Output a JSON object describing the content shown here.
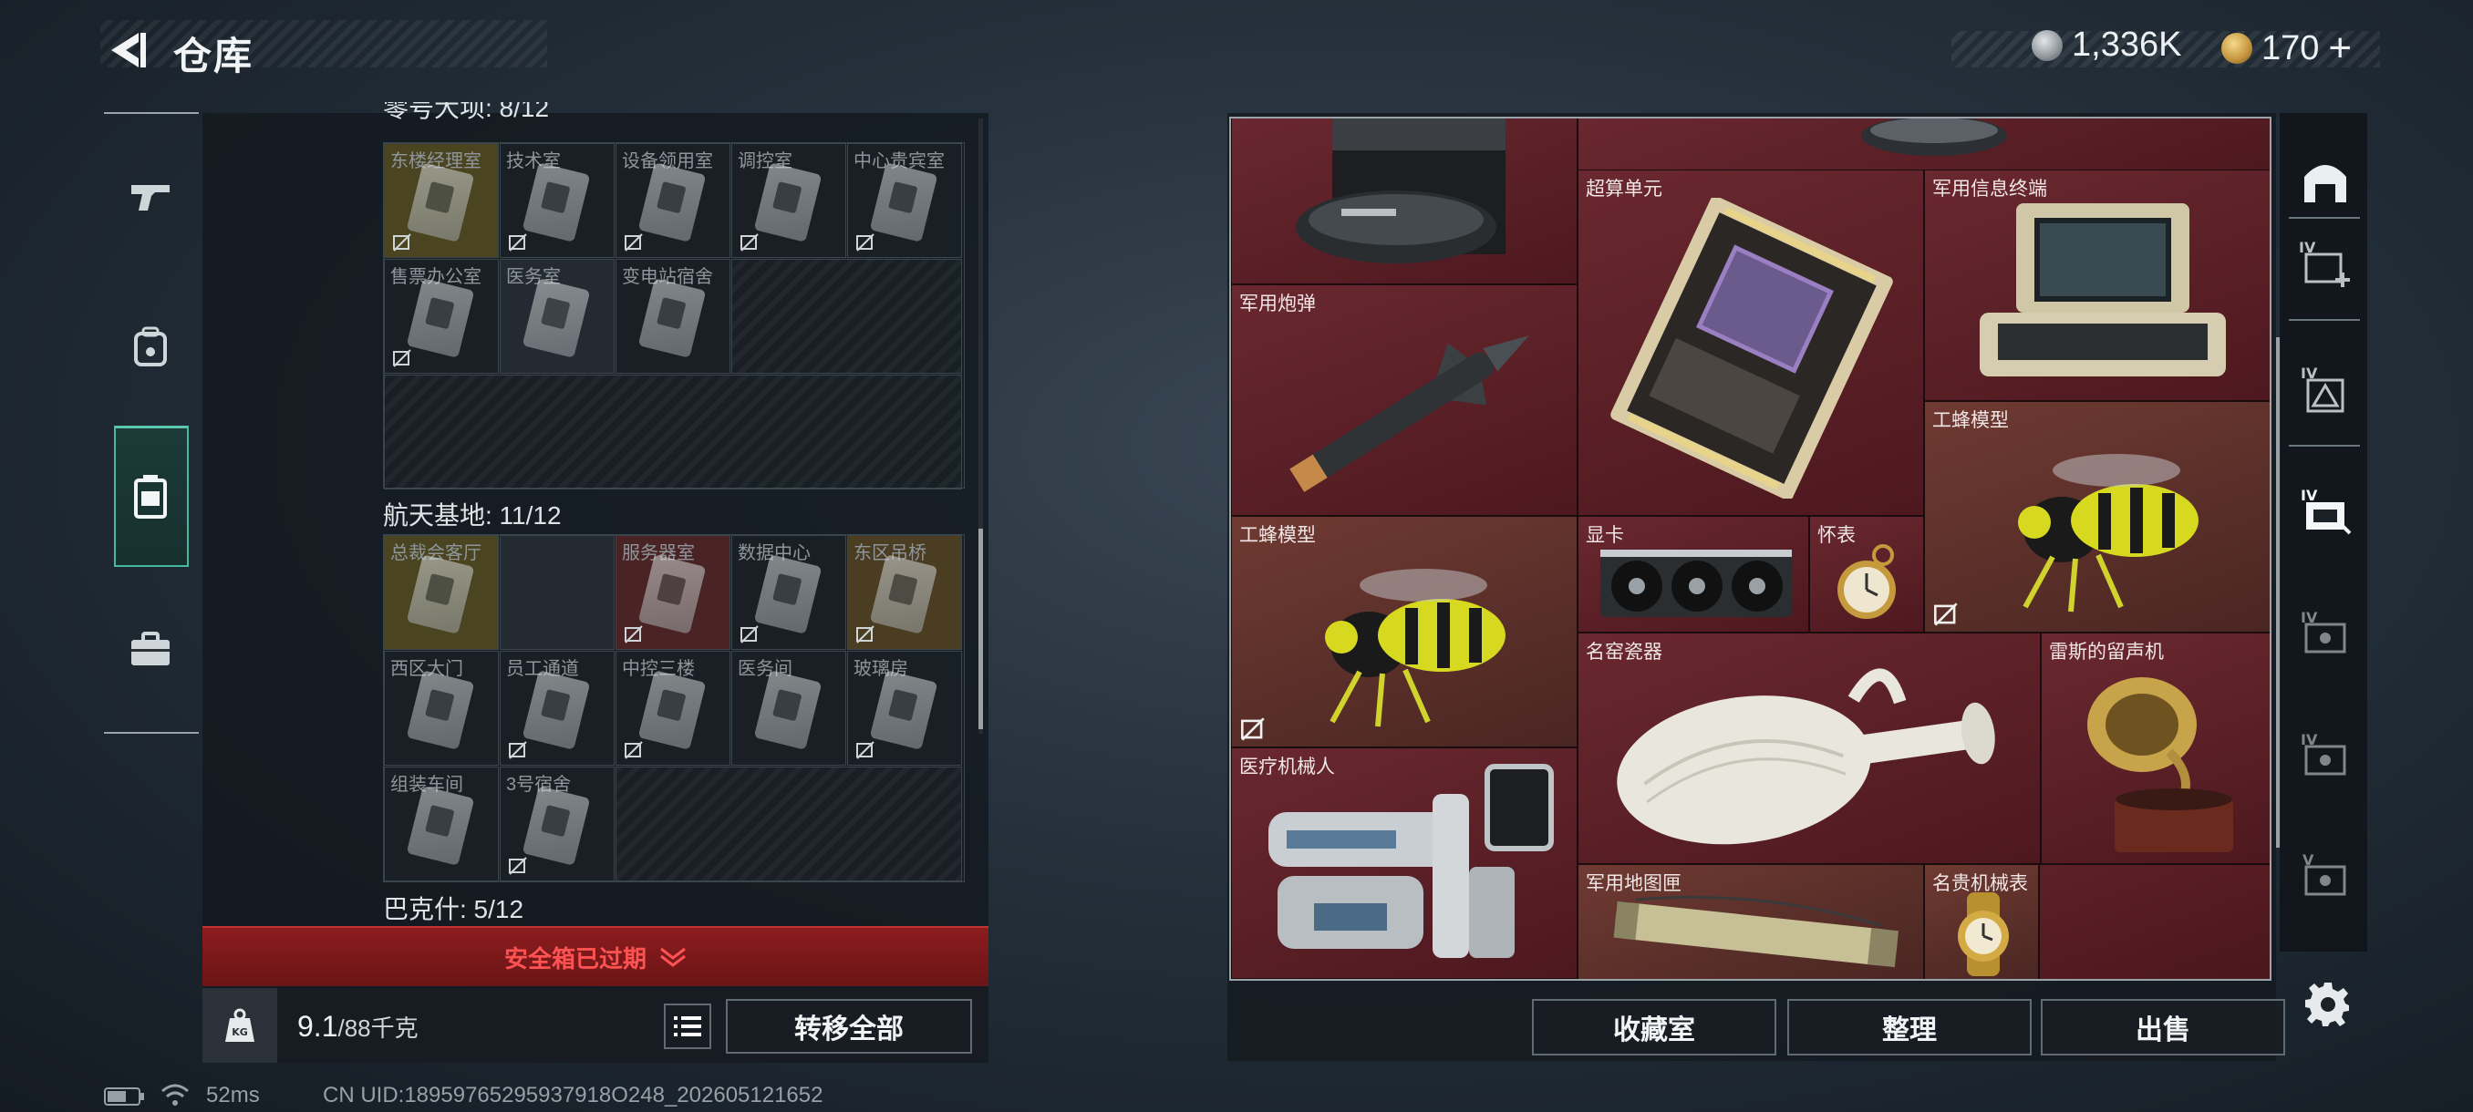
{
  "header": {
    "title": "仓库",
    "currency_1": "1,336K",
    "currency_2": "170",
    "plus": "+"
  },
  "left_rail": {
    "icons": [
      "pistol-icon",
      "backpack-icon",
      "locker-icon",
      "briefcase-icon"
    ],
    "selected": 2
  },
  "sections": [
    {
      "heading_partial": "零号大坝: 8/12",
      "cells": [
        {
          "name": "东楼经理室",
          "locked": true,
          "color": "#6b6322"
        },
        {
          "name": "技术室",
          "locked": true
        },
        {
          "name": "设备领用室",
          "locked": true
        },
        {
          "name": "调控室",
          "locked": true
        },
        {
          "name": "中心贵宾室",
          "locked": true
        },
        {
          "name": "售票办公室",
          "locked": true
        },
        {
          "name": "医务室",
          "locked": false
        },
        {
          "name": "变电站宿舍",
          "locked": false
        }
      ]
    },
    {
      "heading": "航天基地: 11/12",
      "cells": [
        {
          "name": "总裁会客厅",
          "locked": false,
          "color": "#6b6322"
        },
        {
          "name": "",
          "locked": false,
          "empty": true
        },
        {
          "name": "服务器室",
          "locked": true,
          "color": "#5a2a2a"
        },
        {
          "name": "数据中心",
          "locked": true
        },
        {
          "name": "东区吊桥",
          "locked": true,
          "color": "#5b4a28"
        },
        {
          "name": "西区大门",
          "locked": false
        },
        {
          "name": "员工通道",
          "locked": true
        },
        {
          "name": "中控三楼",
          "locked": true
        },
        {
          "name": "医务间",
          "locked": false
        },
        {
          "name": "玻璃房",
          "locked": true
        },
        {
          "name": "组装车间",
          "locked": false
        },
        {
          "name": "3号宿舍",
          "locked": true
        }
      ]
    },
    {
      "heading": "巴克什: 5/12"
    }
  ],
  "warning": "安全箱已过期",
  "footer": {
    "weight": "9.1",
    "capacity": "/88千克",
    "kg_label": "KG",
    "transfer_all": "转移全部"
  },
  "status": {
    "ping": "52ms",
    "uid": "CN UID:18959765295937918O248_202605121652"
  },
  "stash": {
    "items": [
      {
        "name": "超算单元"
      },
      {
        "name": "军用信息终端"
      },
      {
        "name": "军用炮弹"
      },
      {
        "name": "工蜂模型",
        "key": "bee1"
      },
      {
        "name": "工蜂模型",
        "key": "bee2"
      },
      {
        "name": "显卡"
      },
      {
        "name": "怀表"
      },
      {
        "name": "名窑瓷器"
      },
      {
        "name": "雷斯的留声机"
      },
      {
        "name": "医疗机械人"
      },
      {
        "name": "军用地图匣"
      },
      {
        "name": "名贵机械表"
      }
    ]
  },
  "buttons": {
    "collection": "收藏室",
    "organize": "整理",
    "sell": "出售"
  },
  "right_rail": {
    "icons": [
      "home-icon",
      "add-case-icon",
      "case-icon",
      "card-case-icon",
      "case-iv-icon",
      "case-iv-icon",
      "case-v-icon"
    ],
    "tier_labels": [
      "IV",
      "IV",
      "IV",
      "IV",
      "IV",
      "V"
    ]
  },
  "colors": {
    "accent": "#49b8a0",
    "warning": "#ff5252",
    "stash_bg": "#5c1e24"
  }
}
